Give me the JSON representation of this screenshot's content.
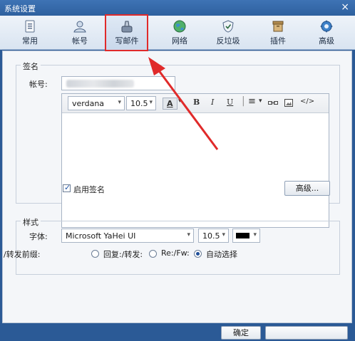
{
  "window": {
    "title": "系统设置",
    "close_glyph": "×"
  },
  "toolbar": {
    "items": [
      {
        "label": "常用",
        "icon": "document-icon"
      },
      {
        "label": "帐号",
        "icon": "user-icon"
      },
      {
        "label": "写邮件",
        "icon": "compose-icon",
        "selected": true
      },
      {
        "label": "网络",
        "icon": "globe-icon"
      },
      {
        "label": "反垃圾",
        "icon": "shield-icon"
      },
      {
        "label": "插件",
        "icon": "plugin-box-icon"
      },
      {
        "label": "高级",
        "icon": "gear-icon"
      }
    ]
  },
  "signature": {
    "group_title": "签名",
    "account_label": "帐号:",
    "account_value_blurred": true,
    "font_value": "verdana",
    "size_value": "10.5",
    "format_buttons": [
      "A",
      "B",
      "I",
      "U"
    ],
    "enable_label": "启用签名",
    "enable_checked": true,
    "advanced_button": "高级..."
  },
  "style": {
    "group_title": "样式",
    "font_label": "字体:",
    "font_value": "Microsoft YaHei UI",
    "size_value": "10.5",
    "color_value": "#000000",
    "prefix_label": "/转发前缀:",
    "options": [
      {
        "label": "回复:/转发:",
        "selected": false
      },
      {
        "label": "Re:/Fw:",
        "selected": false
      },
      {
        "label": "自动选择",
        "selected": true
      }
    ]
  },
  "footer": {
    "ok_button": "确定",
    "cancel_button": ""
  },
  "colors": {
    "titlebar": "#2e609e",
    "highlight": "#e02a2a",
    "accent": "#1f4f9a"
  }
}
